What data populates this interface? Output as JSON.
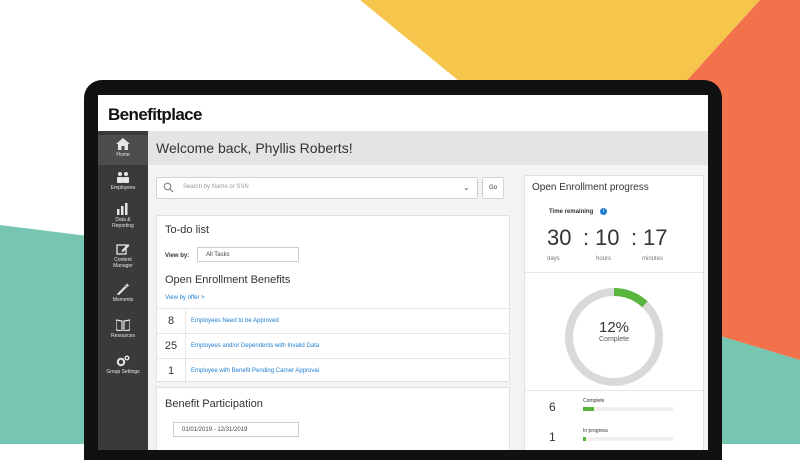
{
  "colors": {
    "accent_yellow": "#F6C54B",
    "accent_orange": "#F2724B",
    "accent_teal": "#76C6B2",
    "link_blue": "#1F7ECF",
    "progress_green": "#5AB53D"
  },
  "brand": "Benefitplace",
  "sidebar": {
    "items": [
      {
        "label": "Home",
        "icon": "home-icon"
      },
      {
        "label": "Employees",
        "icon": "people-icon"
      },
      {
        "label": "Data &",
        "label2": "Reporting",
        "icon": "bar-chart-icon"
      },
      {
        "label": "Content",
        "label2": "Manager",
        "icon": "edit-icon"
      },
      {
        "label": "Moments",
        "icon": "wand-icon"
      },
      {
        "label": "Resources",
        "icon": "book-icon"
      },
      {
        "label": "Group Settings",
        "icon": "gear-icon"
      }
    ]
  },
  "welcome": "Welcome back, Phyllis Roberts!",
  "search": {
    "placeholder": "Search by Name or SSN",
    "go_label": "Go"
  },
  "todo": {
    "title": "To-do list",
    "view_by_label": "View by:",
    "view_by_value": "All Tasks",
    "section_title": "Open Enrollment Benefits",
    "view_by_offer": "View by offer >",
    "rows": [
      {
        "count": "8",
        "label": "Employees Need to be Approved"
      },
      {
        "count": "25",
        "label": "Employees and/or Dependents with Invalid Data"
      },
      {
        "count": "1",
        "label": "Employee with Benefit Pending Carrier Approval"
      }
    ]
  },
  "benefit_participation": {
    "title": "Benefit Participation",
    "date_range": "01/01/2019 - 12/31/2019"
  },
  "enrollment": {
    "title": "Open Enrollment progress",
    "time_remaining_label": "Time remaining",
    "days": "30",
    "hours": "10",
    "minutes": "17",
    "sep": ":",
    "days_label": "days",
    "hours_label": "hours",
    "minutes_label": "minutes",
    "percent_text": "12%",
    "percent_value": 0.12,
    "complete_label": "Complete",
    "stats": [
      {
        "count": "6",
        "label": "Complete",
        "fraction": 0.12
      },
      {
        "count": "1",
        "label": "In progress",
        "fraction": 0.02
      }
    ]
  }
}
